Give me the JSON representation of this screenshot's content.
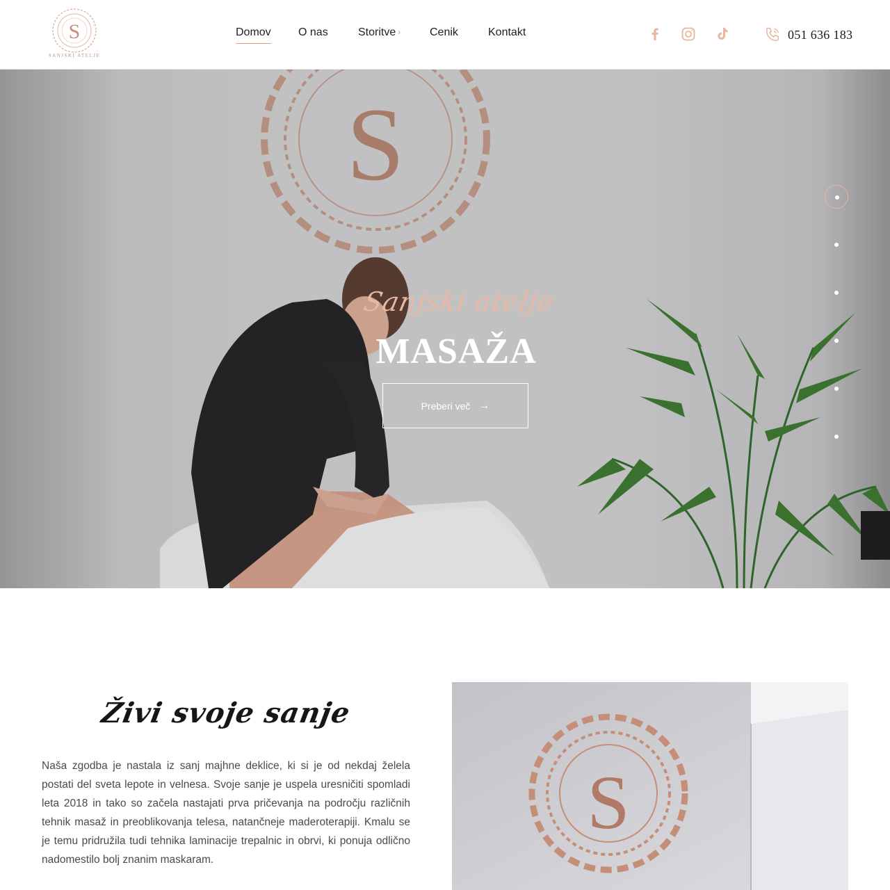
{
  "brand": {
    "logo_text": "SANJSKI ATELJE",
    "accent": "#d8a48d",
    "rose_gold": "#c98f76"
  },
  "header": {
    "nav": [
      {
        "label": "Domov",
        "active": true
      },
      {
        "label": "O nas",
        "active": false
      },
      {
        "label": "Storitve",
        "active": false,
        "has_submenu": true
      },
      {
        "label": "Cenik",
        "active": false
      },
      {
        "label": "Kontakt",
        "active": false
      }
    ],
    "social": [
      "facebook-icon",
      "instagram-icon",
      "tiktok-icon"
    ],
    "phone": "051 636 183"
  },
  "hero": {
    "script_title": "Sanjski atelje",
    "title": "MASAŽA",
    "button_label": "Preberi več",
    "slides_total": 6,
    "active_slide": 1
  },
  "about": {
    "heading": "Živi svoje sanje",
    "text": "Naša zgodba je nastala iz sanj majhne deklice, ki si je od nekdaj želela postati del sveta lepote in velnesa. Svoje sanje je uspela uresničiti spomladi leta 2018 in tako so začela nastajati prva pričevanja na področju različnih tehnik masaž in preoblikovanja telesa, natančneje maderoterapiji. Kmalu se je temu pridružila tudi tehnika laminacije trepalnic in obrvi, ki ponuja odlično nadomestilo bolj znanim maskaram."
  }
}
